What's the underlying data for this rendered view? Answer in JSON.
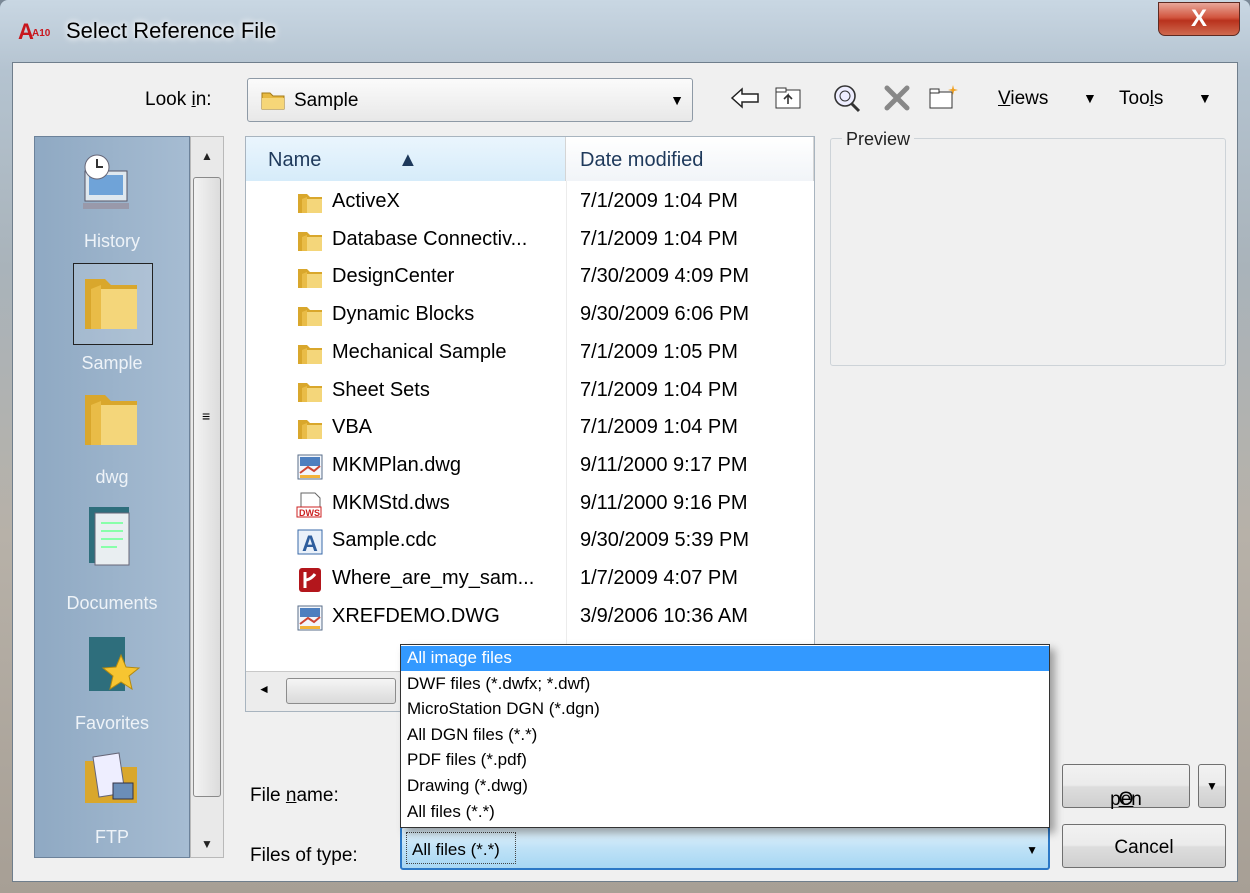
{
  "window": {
    "app_icon_text": "A10",
    "title": "Select Reference File",
    "close_label": "X"
  },
  "lookin": {
    "label_pre": "Look ",
    "label_accel": "i",
    "label_post": "n:",
    "value": "Sample"
  },
  "toolbar": {
    "icons": [
      "back-arrow-icon",
      "up-one-level-icon",
      "search-web-icon",
      "delete-icon",
      "create-new-folder-icon"
    ],
    "views_accel": "V",
    "views_rest": "iews",
    "tools_pre": "Too",
    "tools_accel": "l",
    "tools_post": "s"
  },
  "places": [
    {
      "label": "History",
      "icon": "history-icon"
    },
    {
      "label": "Sample",
      "icon": "folder-icon"
    },
    {
      "label": "dwg",
      "icon": "folder-icon"
    },
    {
      "label": "Documents",
      "icon": "documents-icon"
    },
    {
      "label": "Favorites",
      "icon": "favorites-icon"
    },
    {
      "label": "FTP",
      "icon": "ftp-icon"
    }
  ],
  "filelist": {
    "columns": [
      "Name",
      "Date modified"
    ],
    "rows": [
      {
        "name": "ActiveX",
        "date": "7/1/2009 1:04 PM",
        "icon": "folder-icon"
      },
      {
        "name": "Database Connectiv...",
        "date": "7/1/2009 1:04 PM",
        "icon": "folder-icon"
      },
      {
        "name": "DesignCenter",
        "date": "7/30/2009 4:09 PM",
        "icon": "folder-icon"
      },
      {
        "name": "Dynamic Blocks",
        "date": "9/30/2009 6:06 PM",
        "icon": "folder-icon"
      },
      {
        "name": "Mechanical Sample",
        "date": "7/1/2009 1:05 PM",
        "icon": "folder-icon"
      },
      {
        "name": "Sheet Sets",
        "date": "7/1/2009 1:04 PM",
        "icon": "folder-icon"
      },
      {
        "name": "VBA",
        "date": "7/1/2009 1:04 PM",
        "icon": "folder-icon"
      },
      {
        "name": "MKMPlan.dwg",
        "date": "9/11/2000 9:17 PM",
        "icon": "dwg-file-icon"
      },
      {
        "name": "MKMStd.dws",
        "date": "9/11/2000 9:16 PM",
        "icon": "dws-file-icon"
      },
      {
        "name": "Sample.cdc",
        "date": "9/30/2009 5:39 PM",
        "icon": "cdc-file-icon"
      },
      {
        "name": "Where_are_my_sam...",
        "date": "1/7/2009 4:07 PM",
        "icon": "pdf-file-icon"
      },
      {
        "name": "XREFDEMO.DWG",
        "date": "3/9/2006 10:36 AM",
        "icon": "dwg-file-icon"
      }
    ]
  },
  "preview": {
    "label": "Preview"
  },
  "filename": {
    "label_pre": "File ",
    "label_accel": "n",
    "label_post": "ame:"
  },
  "filetype": {
    "label": "Files of type:",
    "value": "All files (*.*)",
    "options": [
      "All image files",
      "DWF files (*.dwfx; *.dwf)",
      "MicroStation DGN (*.dgn)",
      "All DGN files (*.*)",
      "PDF files (*.pdf)",
      "Drawing (*.dwg)",
      "All files (*.*)"
    ],
    "selected_index": 0
  },
  "buttons": {
    "open_accel": "O",
    "open_rest": "pen",
    "cancel": "Cancel"
  }
}
